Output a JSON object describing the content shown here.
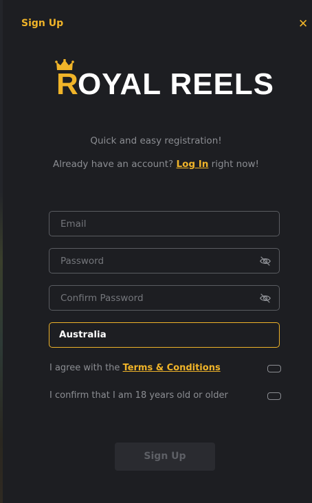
{
  "header": {
    "title": "Sign Up",
    "close_icon": "close-icon",
    "close_glyph": "✕"
  },
  "logo": {
    "text_first_letter": "R",
    "text_rest": "OYAL REELS",
    "crown_icon": "crown-icon",
    "first_letter_color": "#f0b429",
    "text_color": "#ffffff"
  },
  "intro": {
    "tagline": "Quick and easy registration!",
    "account_prefix": "Already have an account?",
    "login_link": "Log In",
    "account_suffix": "right now!"
  },
  "form": {
    "email_placeholder": "Email",
    "password_placeholder": "Password",
    "confirm_password_placeholder": "Confirm Password",
    "country_value": "Australia",
    "password_toggle_icon": "eye-off-icon",
    "terms_prefix": "I agree with the",
    "terms_link": "Terms & Conditions",
    "age_confirm": "I confirm that I am 18 years old or older",
    "submit_label": "Sign Up"
  },
  "colors": {
    "accent": "#f0b429",
    "background": "#1d1e22",
    "muted_text": "#8c8e93",
    "field_border": "#5b5d62"
  }
}
